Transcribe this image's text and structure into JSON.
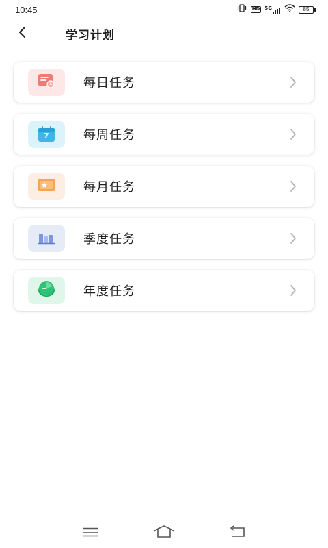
{
  "status_bar": {
    "time": "10:45",
    "hd_label": "HD",
    "network_label": "5G",
    "battery_level": "85",
    "icons": [
      "vibrate-icon",
      "hd-icon",
      "signal-icon",
      "wifi-icon",
      "battery-icon"
    ]
  },
  "header": {
    "title": "学习计划",
    "back_icon": "chevron-left-icon"
  },
  "tasks": [
    {
      "label": "每日任务",
      "icon": "daily-calendar-icon",
      "tile_color": "#fde7e7",
      "icon_color": "#f07a75"
    },
    {
      "label": "每周任务",
      "icon": "weekly-calendar-icon",
      "tile_color": "#dcf3fb",
      "icon_color": "#3fb6e8",
      "icon_text": "7"
    },
    {
      "label": "每月任务",
      "icon": "monthly-star-icon",
      "tile_color": "#fdeee3",
      "icon_color": "#f5a550"
    },
    {
      "label": "季度任务",
      "icon": "quarterly-bar-chart-icon",
      "tile_color": "#e6ebf8",
      "icon_color": "#7d97dc"
    },
    {
      "label": "年度任务",
      "icon": "annual-pie-chart-icon",
      "tile_color": "#e1f6ea",
      "icon_color": "#2fc277"
    }
  ],
  "nav_bar": {
    "icons": [
      "menu-icon",
      "home-icon",
      "back-icon"
    ]
  }
}
